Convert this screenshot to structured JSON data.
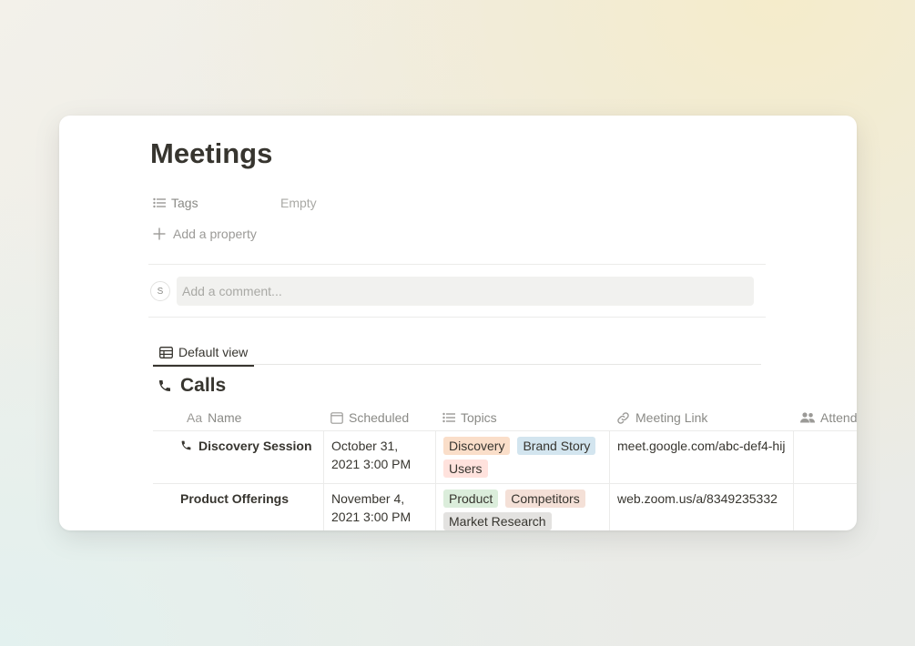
{
  "page": {
    "title": "Meetings",
    "properties": [
      {
        "icon": "list-icon",
        "label": "Tags",
        "value": "Empty"
      }
    ],
    "add_property_label": "Add a property",
    "comment": {
      "avatar_initial": "S",
      "placeholder": "Add a comment..."
    }
  },
  "view": {
    "icon": "table-icon",
    "label": "Default view"
  },
  "section": {
    "icon": "phone-icon",
    "title": "Calls"
  },
  "table": {
    "columns": [
      {
        "icon": "Aa",
        "label": "Name"
      },
      {
        "icon": "calendar-icon",
        "label": "Scheduled"
      },
      {
        "icon": "list-icon",
        "label": "Topics"
      },
      {
        "icon": "link-icon",
        "label": "Meeting Link"
      },
      {
        "icon": "people-icon",
        "label": "Attend"
      }
    ],
    "rows": [
      {
        "icon": "phone-icon",
        "name": "Discovery Session",
        "scheduled": "October 31, 2021 3:00 PM",
        "topics": [
          {
            "label": "Discovery",
            "color": "#fadec9"
          },
          {
            "label": "Brand Story",
            "color": "#d3e5ef"
          },
          {
            "label": "Users",
            "color": "#ffe2dd"
          }
        ],
        "link": "meet.google.com/abc-def4-hij",
        "attendees": ""
      },
      {
        "icon": "",
        "name": "Product Offerings",
        "scheduled": "November 4, 2021 3:00 PM",
        "topics": [
          {
            "label": "Product",
            "color": "#dbeddb"
          },
          {
            "label": "Competitors",
            "color": "#f4e0d7"
          },
          {
            "label": "Market Research",
            "color": "#e3e2e0"
          }
        ],
        "link": "web.zoom.us/a/8349235332",
        "attendees": ""
      }
    ]
  }
}
